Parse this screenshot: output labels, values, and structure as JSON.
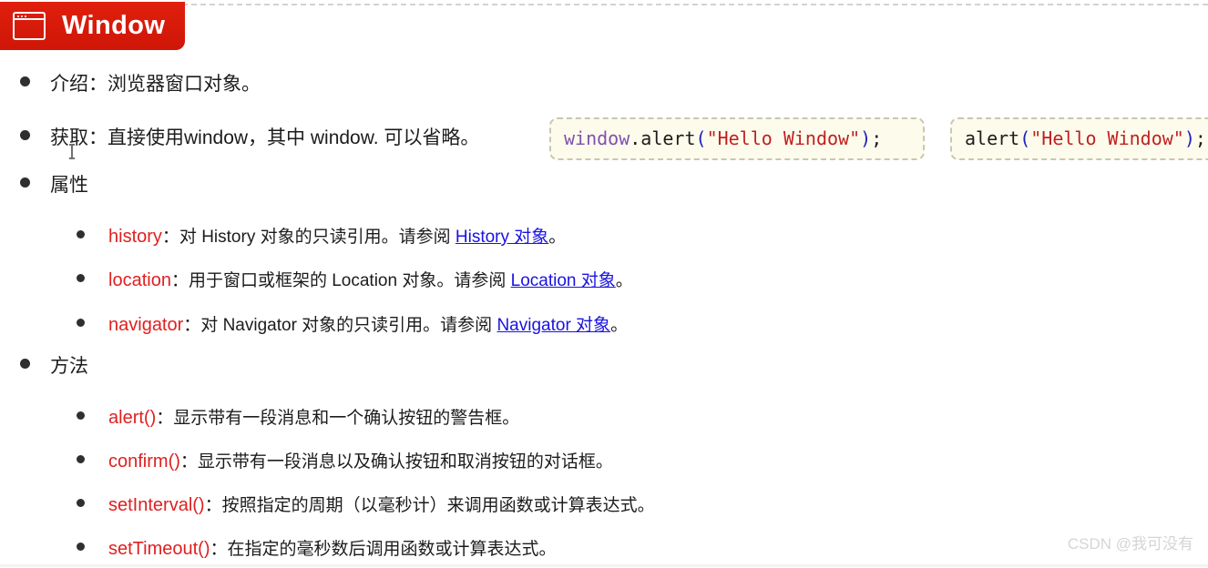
{
  "header": {
    "title": "Window",
    "icon": "browser-window-icon",
    "background_color": "#d81b0a",
    "text_color": "#ffffff"
  },
  "colors": {
    "banner_red": "#d81b0a",
    "term_red": "#e02020",
    "link_blue": "#1a13e0",
    "code_bg": "#fdfcec",
    "code_border": "#c9c6b4",
    "watermark_gray": "#d5d5d5"
  },
  "sections": {
    "intro": {
      "label": "介绍：",
      "text": "浏览器窗口对象。"
    },
    "access": {
      "label": "获取：",
      "text": "直接使用window，其中 window. 可以省略。"
    },
    "properties_heading": "属性",
    "methods_heading": "方法"
  },
  "code_blocks": [
    {
      "object": "window",
      "dot": ".",
      "fn": "alert",
      "open": "(",
      "string": "\"Hello Window\"",
      "close": ")",
      "semi": ";"
    },
    {
      "object": "",
      "dot": "",
      "fn": "alert",
      "open": "(",
      "string": "\"Hello Window\"",
      "close": ")",
      "semi": ";"
    }
  ],
  "properties": [
    {
      "name": "history",
      "sep": "：",
      "desc_before": "对 History 对象的只读引用。请参阅 ",
      "link": "History 对象",
      "desc_after": "。"
    },
    {
      "name": "location",
      "sep": "：",
      "desc_before": "用于窗口或框架的 Location 对象。请参阅 ",
      "link": "Location 对象",
      "desc_after": "。"
    },
    {
      "name": "navigator",
      "sep": "：",
      "desc_before": "对 Navigator 对象的只读引用。请参阅 ",
      "link": "Navigator 对象",
      "desc_after": "。"
    }
  ],
  "methods": [
    {
      "name": "alert()",
      "sep": "：",
      "desc": "显示带有一段消息和一个确认按钮的警告框。"
    },
    {
      "name": "confirm()",
      "sep": "：",
      "desc": "显示带有一段消息以及确认按钮和取消按钮的对话框。"
    },
    {
      "name": "setInterval()",
      "sep": "：",
      "desc": "按照指定的周期（以毫秒计）来调用函数或计算表达式。"
    },
    {
      "name": "setTimeout()",
      "sep": "：",
      "desc": "在指定的毫秒数后调用函数或计算表达式。"
    }
  ],
  "watermark": "CSDN @我可没有"
}
